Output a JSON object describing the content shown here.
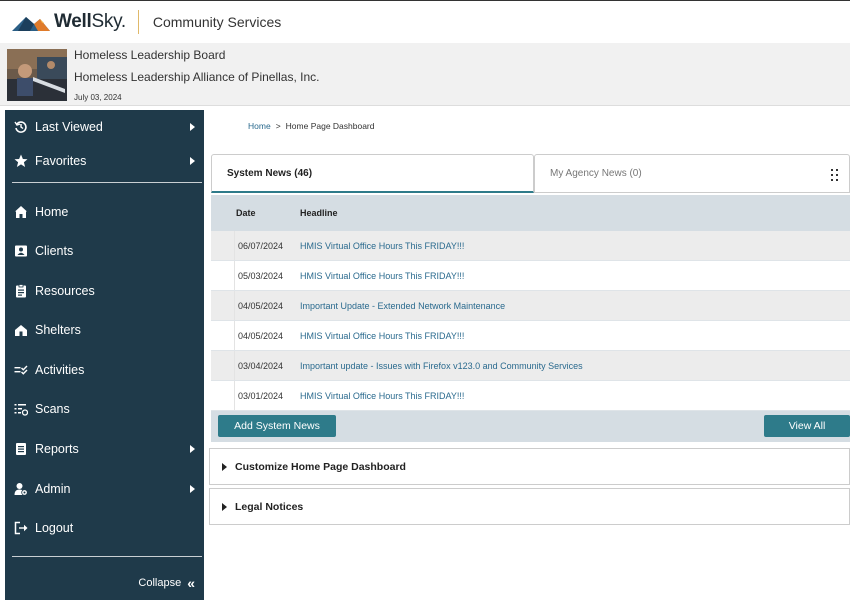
{
  "header": {
    "logo_brand": "Well",
    "logo_brand_light": "Sky.",
    "app_name": "Community Services"
  },
  "agency": {
    "line1": "Homeless Leadership Board",
    "line2": "Homeless Leadership Alliance of Pinellas, Inc.",
    "date": "July 03, 2024"
  },
  "sidebar": {
    "items": [
      {
        "label": "Last Viewed",
        "icon": "history-icon",
        "has_submenu": true
      },
      {
        "label": "Favorites",
        "icon": "star-icon",
        "has_submenu": true
      },
      {
        "label": "Home",
        "icon": "home-icon",
        "has_submenu": false
      },
      {
        "label": "Clients",
        "icon": "id-card-icon",
        "has_submenu": false
      },
      {
        "label": "Resources",
        "icon": "clipboard-icon",
        "has_submenu": false
      },
      {
        "label": "Shelters",
        "icon": "house-icon",
        "has_submenu": false
      },
      {
        "label": "Activities",
        "icon": "checklist-icon",
        "has_submenu": false
      },
      {
        "label": "Scans",
        "icon": "scan-list-icon",
        "has_submenu": false
      },
      {
        "label": "Reports",
        "icon": "report-icon",
        "has_submenu": true
      },
      {
        "label": "Admin",
        "icon": "admin-gear-icon",
        "has_submenu": true
      },
      {
        "label": "Logout",
        "icon": "logout-icon",
        "has_submenu": false
      }
    ],
    "collapse_label": "Collapse",
    "collapse_glyph": "«",
    "bg_color": "#1f3a4a"
  },
  "breadcrumb": {
    "home": "Home",
    "separator": ">",
    "current": "Home Page Dashboard"
  },
  "news": {
    "tabs": [
      {
        "label": "System News (46)",
        "active": true
      },
      {
        "label": "My Agency News (0)",
        "active": false
      }
    ],
    "columns": [
      "Date",
      "Headline"
    ],
    "rows": [
      {
        "date": "06/07/2024",
        "headline": "HMIS Virtual Office Hours This FRIDAY!!!"
      },
      {
        "date": "05/03/2024",
        "headline": "HMIS Virtual Office Hours This FRIDAY!!!"
      },
      {
        "date": "04/05/2024",
        "headline": "Important Update - Extended Network Maintenance"
      },
      {
        "date": "04/05/2024",
        "headline": "HMIS Virtual Office Hours This FRIDAY!!!"
      },
      {
        "date": "03/04/2024",
        "headline": "Important update - Issues with Firefox v123.0 and Community Services"
      },
      {
        "date": "03/01/2024",
        "headline": "HMIS Virtual Office Hours This FRIDAY!!!"
      }
    ],
    "add_button": "Add System News",
    "view_all_button": "View All"
  },
  "sections": [
    {
      "label": "Customize Home Page Dashboard"
    },
    {
      "label": "Legal Notices"
    }
  ],
  "colors": {
    "accent": "#2e7b8a",
    "link": "#2a6a8e",
    "table_header": "#d5dde3"
  }
}
